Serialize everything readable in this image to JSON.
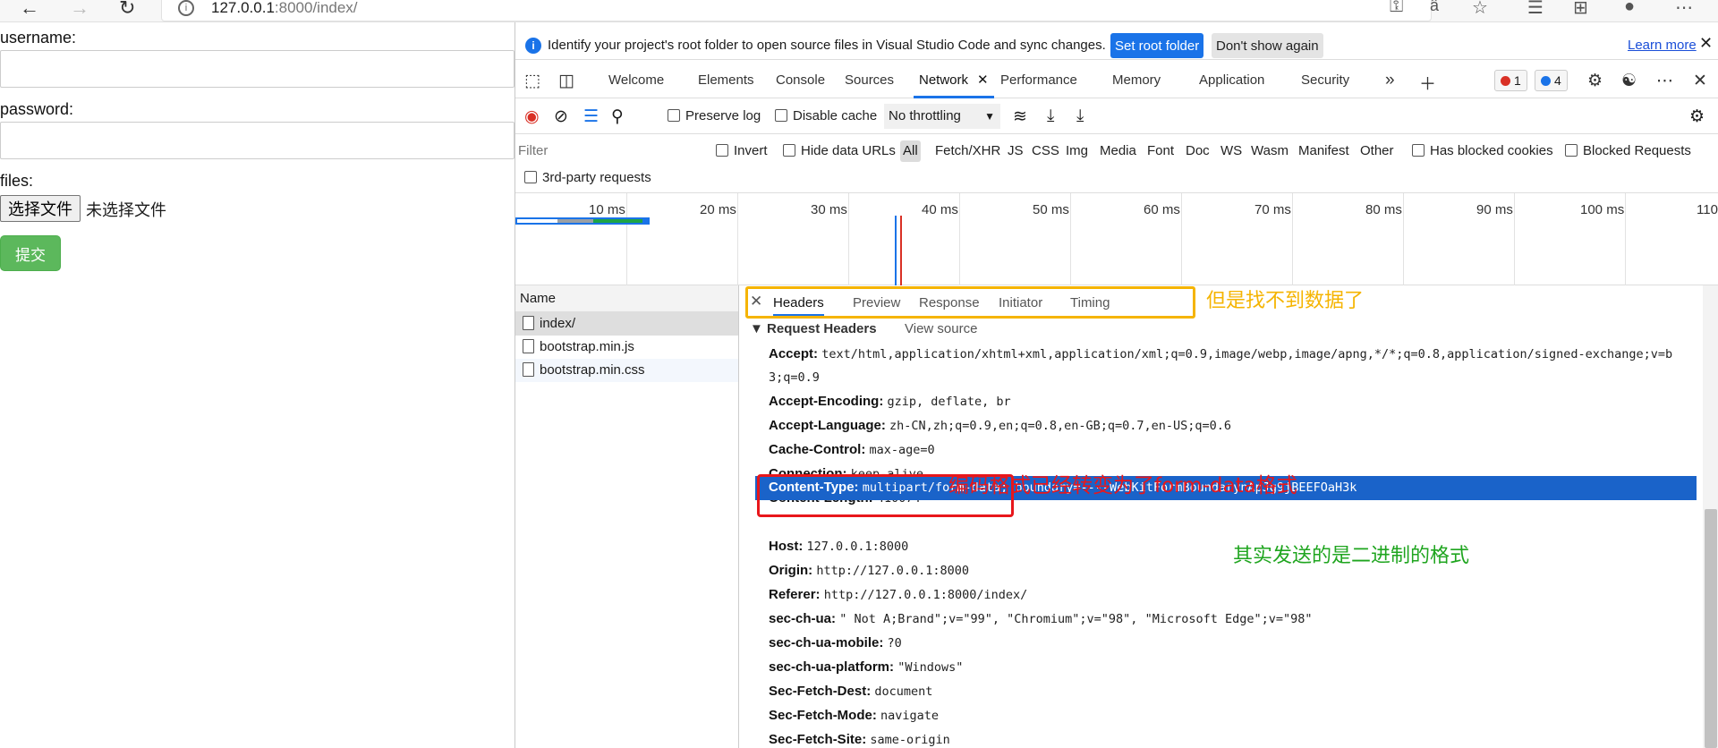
{
  "browser": {
    "url_host": "127.0.0.1",
    "url_rest": ":8000/index/"
  },
  "form": {
    "username_label": "username:",
    "password_label": "password:",
    "files_label": "files:",
    "file_button": "选择文件",
    "file_status": "未选择文件",
    "submit": "提交"
  },
  "infobar": {
    "message": "Identify your project's root folder to open source files in Visual Studio Code and sync changes.",
    "set_root": "Set root folder",
    "dont_show": "Don't show again",
    "learn_more": "Learn more"
  },
  "tabs": [
    {
      "label": "Welcome"
    },
    {
      "label": "Elements"
    },
    {
      "label": "Console"
    },
    {
      "label": "Sources"
    },
    {
      "label": "Network"
    },
    {
      "label": "Performance"
    },
    {
      "label": "Memory"
    },
    {
      "label": "Application"
    },
    {
      "label": "Security"
    }
  ],
  "badges": {
    "errors": "1",
    "messages": "4"
  },
  "controls": {
    "preserve_log": "Preserve log",
    "disable_cache": "Disable cache",
    "throttling": "No throttling"
  },
  "filterbar": {
    "placeholder": "Filter",
    "invert": "Invert",
    "hide_data_urls": "Hide data URLs",
    "types": [
      "All",
      "Fetch/XHR",
      "JS",
      "CSS",
      "Img",
      "Media",
      "Font",
      "Doc",
      "WS",
      "Wasm",
      "Manifest",
      "Other"
    ],
    "has_blocked_cookies": "Has blocked cookies",
    "blocked_requests": "Blocked Requests",
    "third_party": "3rd-party requests"
  },
  "timeline": {
    "ticks": [
      "10 ms",
      "20 ms",
      "30 ms",
      "40 ms",
      "50 ms",
      "60 ms",
      "70 ms",
      "80 ms",
      "90 ms",
      "100 ms",
      "110"
    ]
  },
  "requests": {
    "header": "Name",
    "items": [
      "index/",
      "bootstrap.min.js",
      "bootstrap.min.css"
    ]
  },
  "detail": {
    "tabs": [
      "Headers",
      "Preview",
      "Response",
      "Initiator",
      "Timing"
    ],
    "section_title": "Request Headers",
    "view_source": "View source",
    "headers": [
      {
        "key": "Accept:",
        "value": "text/html,application/xhtml+xml,application/xml;q=0.9,image/webp,image/apng,*/*;q=0.8,application/signed-exchange;v=b"
      },
      {
        "key": "",
        "value": "3;q=0.9"
      },
      {
        "key": "Accept-Encoding:",
        "value": "gzip, deflate, br"
      },
      {
        "key": "Accept-Language:",
        "value": "zh-CN,zh;q=0.9,en;q=0.8,en-GB;q=0.7,en-US;q=0.6"
      },
      {
        "key": "Cache-Control:",
        "value": "max-age=0"
      },
      {
        "key": "Connection:",
        "value": "keep-alive"
      },
      {
        "key": "Content-Length:",
        "value": "410074"
      },
      {
        "key": "Content-Type:",
        "value": "multipart/form-data; boundary=----WebKitFormBoundarynApJg9jBEEFOaH3k"
      },
      {
        "key": "Host:",
        "value": "127.0.0.1:8000"
      },
      {
        "key": "Origin:",
        "value": "http://127.0.0.1:8000"
      },
      {
        "key": "Referer:",
        "value": "http://127.0.0.1:8000/index/"
      },
      {
        "key": "sec-ch-ua:",
        "value": "\" Not A;Brand\";v=\"99\", \"Chromium\";v=\"98\", \"Microsoft Edge\";v=\"98\""
      },
      {
        "key": "sec-ch-ua-mobile:",
        "value": "?0"
      },
      {
        "key": "sec-ch-ua-platform:",
        "value": "\"Windows\""
      },
      {
        "key": "Sec-Fetch-Dest:",
        "value": "document"
      },
      {
        "key": "Sec-Fetch-Mode:",
        "value": "navigate"
      },
      {
        "key": "Sec-Fetch-Site:",
        "value": "same-origin"
      }
    ]
  },
  "annotations": {
    "no_data": "但是找不到数据了",
    "encoding_changed": "编码格式已经转变为了form-data格式",
    "binary_sent": "其实发送的是二进制的格式"
  },
  "colors": {
    "accent_blue": "#1a73e8",
    "selected_row": "#1a63c9",
    "annot_yellow": "#f5b400",
    "annot_red": "#e8171b",
    "annot_green": "#1fa51f",
    "submit_green": "#5cb85c"
  }
}
